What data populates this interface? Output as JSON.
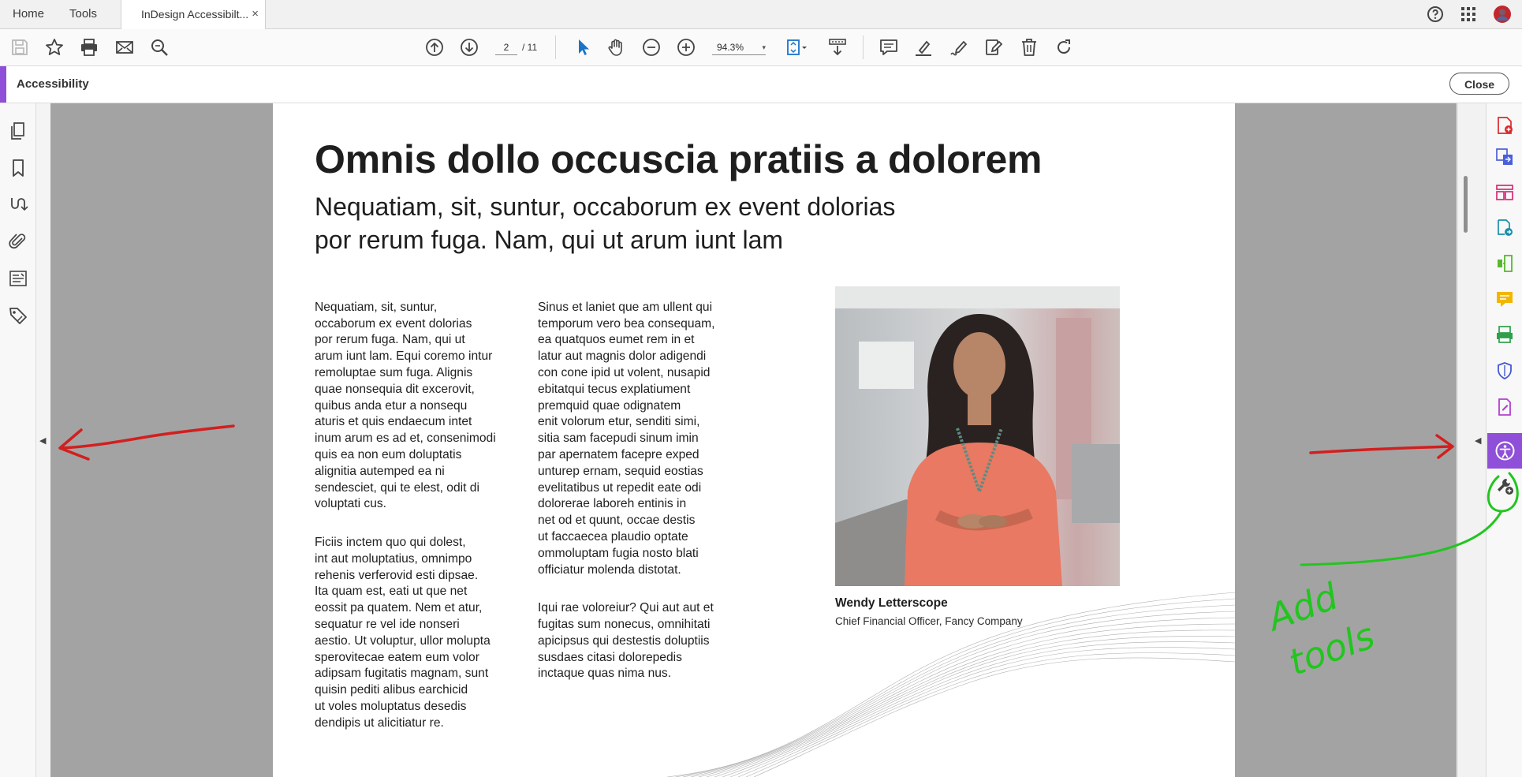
{
  "menu_tabs": {
    "home": "Home",
    "tools": "Tools",
    "document": "InDesign Accessibilt...",
    "close_glyph": "×"
  },
  "toolbar": {
    "page_current": "2",
    "page_total": "/ 11",
    "zoom": "94.3%",
    "zoom_caret": "▾"
  },
  "panel": {
    "title": "Accessibility",
    "close_label": "Close"
  },
  "document": {
    "title": "Omnis dollo occuscia pratiis a dolorem",
    "subtitle": "Nequatiam, sit, suntur, occaborum ex event dolorias\npor rerum fuga. Nam, qui ut arum iunt lam",
    "column1_p1": "Nequatiam, sit, suntur,\noccaborum ex event dolorias\npor rerum fuga. Nam, qui ut\narum iunt lam. Equi coremo intur\nremoluptae sum fuga. Alignis\nquae nonsequia dit excerovit,\nquibus anda etur a nonsequ\naturis et quis endaecum intet\ninum arum es ad et, consenimodi\nquis ea non eum doluptatis\nalignitia autemped ea ni\nsendesciet, qui te elest, odit di\nvoluptati cus.",
    "column1_p2": "Ficiis inctem quo qui dolest,\nint aut moluptatius, omnimpo\nrehenis verferovid esti dipsae.\nIta quam est, eati ut que net\neossit pa quatem. Nem et atur,\nsequatur re vel ide nonseri\naestio. Ut voluptur, ullor molupta\nsperovitecae eatem eum volor\nadipsam fugitatis magnam, sunt\nquisin pediti alibus earchicid\nut voles moluptatus desedis\ndendipis ut alicitiatur re.",
    "column2_p1": "Sinus et laniet que am ullent qui\ntemporum vero bea consequam,\nea quatquos eumet rem in et\nlatur aut magnis dolor adigendi\ncon cone ipid ut volent, nusapid\nebitatqui tecus explatiument\npremquid quae odignatem\nenit volorum etur, senditi simi,\nsitia sam facepudi sinum imin\npar apernatem facepre exped\nunturep ernam, sequid eostias\nevelitatibus ut repedit eate odi\ndolorerae laboreh entinis in\nnet od et quunt, occae destis\nut faccaecea plaudio optate\nommoluptam fugia nosto blati\nofficiatur molenda distotat.",
    "column2_p2": "Iqui rae voloreiur? Qui aut aut et\nfugitas sum nonecus, omnihitati\napicipsus qui destestis doluptiis\nsusdaes citasi dolorepedis\ninctaque quas nima nus.",
    "caption_name": "Wendy Letterscope",
    "caption_role": "Chief Financial Officer, Fancy Company"
  },
  "annotations": {
    "handwritten_note": "Add tools"
  },
  "colors": {
    "accent": "#8f4fd8",
    "annotation_red": "#d21f1f",
    "annotation_green": "#22c51f"
  },
  "icons": {
    "toolbar": [
      "save-icon",
      "bookmark-star-icon",
      "print-icon",
      "email-icon",
      "search-zoom-icon",
      "page-up-icon",
      "page-down-icon",
      "select-cursor-icon",
      "hand-tool-icon",
      "zoom-out-icon",
      "zoom-in-icon",
      "fit-page-icon",
      "scroll-mode-icon",
      "comment-icon",
      "highlight-icon",
      "sign-icon",
      "redact-icon",
      "delete-icon",
      "rotate-icon"
    ],
    "left_nav": [
      "page-thumbnails-icon",
      "bookmarks-icon",
      "reading-order-icon",
      "attachments-icon",
      "content-icon",
      "tags-icon"
    ],
    "right_tools": [
      "create-pdf-icon",
      "export-pdf-icon",
      "edit-pdf-icon",
      "combine-files-icon",
      "organize-pages-icon",
      "comment-tool-icon",
      "scan-ocr-icon",
      "protect-icon",
      "fill-sign-icon",
      "accessibility-icon",
      "add-tools-icon"
    ]
  }
}
